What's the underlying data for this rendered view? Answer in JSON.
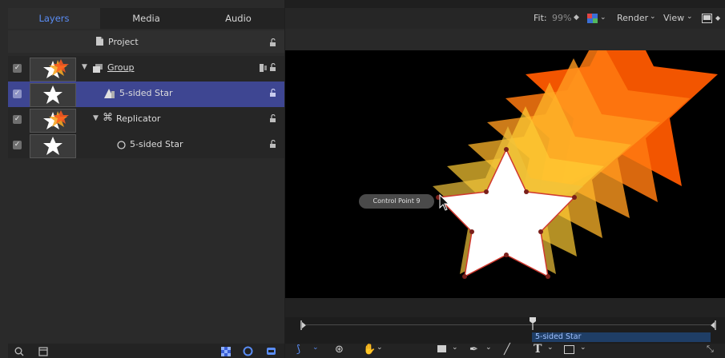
{
  "tabs": [
    {
      "label": "Layers",
      "active": true
    },
    {
      "label": "Media",
      "active": false
    },
    {
      "label": "Audio",
      "active": false
    }
  ],
  "project_label": "Project",
  "layers": [
    {
      "label": "Group",
      "selected": false,
      "thumb": "fire-star"
    },
    {
      "label": "5-sided Star",
      "selected": true,
      "thumb": "white-star"
    },
    {
      "label": "Replicator",
      "selected": false,
      "thumb": "fire-star"
    },
    {
      "label": "5-sided Star",
      "selected": false,
      "thumb": "white-star"
    }
  ],
  "toolbar": {
    "fit_label": "Fit:",
    "fit_value": "99%",
    "render_label": "Render",
    "view_label": "View"
  },
  "canvas": {
    "tooltip": "Control Point 9"
  },
  "timeline": {
    "clip_label": "5-sided Star"
  },
  "colors": {
    "accent": "#5a8df5",
    "selection": "#3e4692",
    "timeline_clip": "#1f3e66"
  }
}
